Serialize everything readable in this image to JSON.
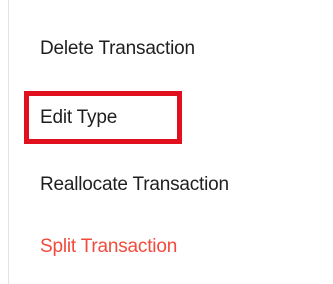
{
  "menu": {
    "items": [
      {
        "label": "Delete Transaction"
      },
      {
        "label": "Edit Type",
        "highlighted": true
      },
      {
        "label": "Reallocate Transaction"
      },
      {
        "label": "Split Transaction",
        "color": "#f04b3c"
      }
    ]
  },
  "colors": {
    "text": "#1f1f1f",
    "accent_red": "#f04b3c",
    "highlight_border": "#e0101f",
    "divider": "#e3e3e3",
    "background": "#ffffff"
  }
}
